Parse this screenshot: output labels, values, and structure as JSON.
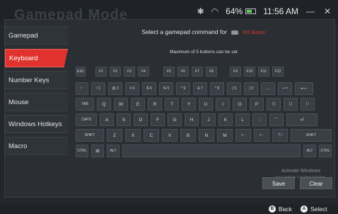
{
  "app": {
    "title": "Gamepad Mode"
  },
  "status": {
    "wifi_icon": "wifi-icon",
    "bluetooth_icon": "bluetooth-icon",
    "battery": "64%",
    "battery_level": 0.64,
    "time": "11:56 AM",
    "minimize": "—",
    "close": "✕"
  },
  "sidebar": {
    "items": [
      {
        "label": "Gamepad",
        "active": false
      },
      {
        "label": "Keyboard",
        "active": true
      },
      {
        "label": "Number Keys",
        "active": false
      },
      {
        "label": "Mouse",
        "active": false
      },
      {
        "label": "Windows Hotkeys",
        "active": false
      },
      {
        "label": "Macro",
        "active": false
      }
    ]
  },
  "main": {
    "prompt": "Select a gamepad command for",
    "target": "M2 Button",
    "subtitle": "Maximum of 5 buttons can be set"
  },
  "keyboard": {
    "rows": [
      [
        {
          "l": "ESC"
        },
        {
          "l": "F1"
        },
        {
          "l": "F2"
        },
        {
          "l": "F3"
        },
        {
          "l": "F4"
        },
        {
          "l": "F5"
        },
        {
          "l": "F6"
        },
        {
          "l": "F7"
        },
        {
          "l": "F8"
        },
        {
          "l": "F9"
        },
        {
          "l": "F10"
        },
        {
          "l": "F11"
        },
        {
          "l": "F12"
        }
      ],
      [
        {
          "l": "~ `"
        },
        {
          "l": "! 1"
        },
        {
          "l": "@ 2"
        },
        {
          "l": "# 3"
        },
        {
          "l": "$ 4"
        },
        {
          "l": "% 5"
        },
        {
          "l": "^ 6"
        },
        {
          "l": "& 7"
        },
        {
          "l": "* 8"
        },
        {
          "l": "( 9"
        },
        {
          "l": ") 0"
        },
        {
          "l": "_ -"
        },
        {
          "l": "+ ="
        },
        {
          "l": "⟵"
        }
      ],
      [
        {
          "l": "TAB"
        },
        {
          "l": "Q"
        },
        {
          "l": "W"
        },
        {
          "l": "E"
        },
        {
          "l": "R"
        },
        {
          "l": "T"
        },
        {
          "l": "Y"
        },
        {
          "l": "U"
        },
        {
          "l": "I"
        },
        {
          "l": "O"
        },
        {
          "l": "P"
        },
        {
          "l": "{ ["
        },
        {
          "l": "} ]"
        },
        {
          "l": "| \\"
        }
      ],
      [
        {
          "l": "CAPS"
        },
        {
          "l": "A"
        },
        {
          "l": "S"
        },
        {
          "l": "D"
        },
        {
          "l": "F"
        },
        {
          "l": "G"
        },
        {
          "l": "H"
        },
        {
          "l": "J"
        },
        {
          "l": "K"
        },
        {
          "l": "L"
        },
        {
          "l": ": ;"
        },
        {
          "l": "\" '"
        },
        {
          "l": "⏎"
        }
      ],
      [
        {
          "l": "SHIFT"
        },
        {
          "l": "Z"
        },
        {
          "l": "X"
        },
        {
          "l": "C"
        },
        {
          "l": "V"
        },
        {
          "l": "B"
        },
        {
          "l": "N"
        },
        {
          "l": "M"
        },
        {
          "l": "< ,"
        },
        {
          "l": "> ."
        },
        {
          "l": "? /"
        },
        {
          "l": "SHIFT"
        }
      ],
      [
        {
          "l": "CTRL"
        },
        {
          "l": "⊞"
        },
        {
          "l": "ALT"
        },
        {
          "l": ""
        },
        {
          "l": "ALT"
        },
        {
          "l": "CTRL"
        }
      ]
    ]
  },
  "actions": {
    "save": "Save",
    "clear": "Clear"
  },
  "watermark": {
    "line1": "Activate Windows",
    "line2": "Go to Settings to activate Windows."
  },
  "bottom": {
    "back_key": "B",
    "back": "Back",
    "select_key": "A",
    "select": "Select"
  }
}
